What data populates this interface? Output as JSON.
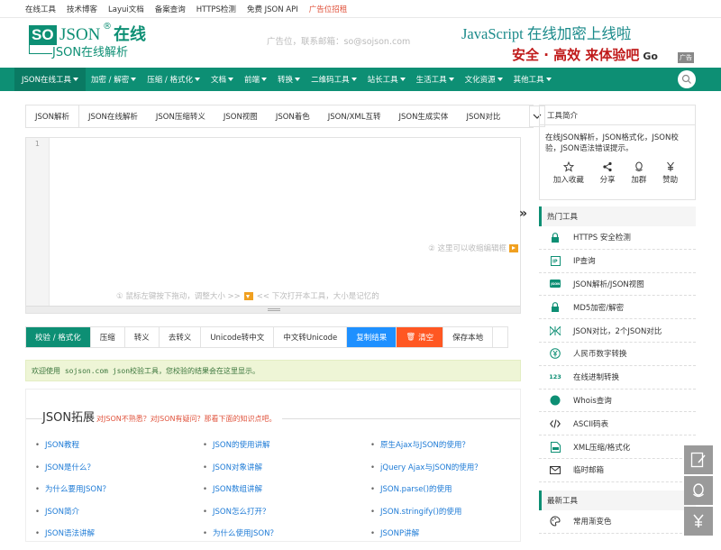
{
  "topbar": {
    "links": [
      "在线工具",
      "技术博客",
      "Layui文档",
      "备案查询",
      "HTTPS检测",
      "免费 JSON API"
    ],
    "ad_link": "广告位招租"
  },
  "header": {
    "logo_so": "SO",
    "logo_json": "JSON",
    "logo_reg": "®",
    "logo_zx": "在线",
    "logo_sub": "JSON在线解析",
    "ad_text": "广告位，联系邮箱：so@sojson.com",
    "banner_line1": "JavaScript 在线加密上线啦",
    "banner_line2": "安全 · 高效  来体验吧",
    "banner_go": "Go",
    "banner_badge": "广告"
  },
  "nav": {
    "items": [
      {
        "label": "JSON在线工具"
      },
      {
        "label": "加密 / 解密"
      },
      {
        "label": "压缩 / 格式化"
      },
      {
        "label": "文档"
      },
      {
        "label": "前端"
      },
      {
        "label": "转换"
      },
      {
        "label": "二维码工具"
      },
      {
        "label": "站长工具"
      },
      {
        "label": "生活工具"
      },
      {
        "label": "文化资源"
      },
      {
        "label": "其他工具"
      }
    ]
  },
  "tabs": [
    "JSON解析",
    "JSON在线解析",
    "JSON压缩转义",
    "JSON视图",
    "JSON着色",
    "JSON/XML互转",
    "JSON生成实体",
    "JSON对比"
  ],
  "editor": {
    "line_no": "1",
    "collapse_hint": "② 这里可以收缩编辑框",
    "drag_hint_1": "① 鼠标左键按下拖动，调整大小 >>",
    "drag_hint_2": "<< 下次打开本工具，大小是记忆的"
  },
  "actions": {
    "validate": "校验 / 格式化",
    "compress": "压缩",
    "escape": "转义",
    "unescape": "去转义",
    "unicode_to_cn": "Unicode转中文",
    "cn_to_unicode": "中文转Unicode",
    "copy": "复制结果",
    "clear": "清空",
    "save": "保存本地"
  },
  "result_text": "欢迎使用 sojson.com json校验工具，您校验的结果会在这里显示。",
  "extension": {
    "title": "JSON拓展",
    "subtitle": "对JSON不熟悉？对JSON有疑问？那看下面的知识点吧。",
    "col1": [
      "JSON教程",
      "JSON是什么？",
      "为什么要用JSON？",
      "JSON简介",
      "JSON语法讲解"
    ],
    "col2": [
      "JSON的使用讲解",
      "JSON对象讲解",
      "JSON数组讲解",
      "JSON怎么打开？",
      "为什么使用JSON？"
    ],
    "col3": [
      "原生Ajax与JSON的使用？",
      "jQuery Ajax与JSON的使用？",
      "JSON.parse()的使用",
      "JSON.stringify()的使用",
      "JSONP讲解"
    ]
  },
  "sidebar": {
    "intro_title": "工具简介",
    "intro_text": "在线JSON解析，JSON格式化，JSON校验，JSON语法错误提示。",
    "actions": [
      {
        "label": "加入收藏",
        "icon": "star-icon"
      },
      {
        "label": "分享",
        "icon": "share-icon"
      },
      {
        "label": "加群",
        "icon": "qq-icon"
      },
      {
        "label": "赞助",
        "icon": "yen-icon"
      }
    ],
    "hot_title": "热门工具",
    "hot_tools": [
      {
        "label": "HTTPS 安全检测",
        "icon": "lock-icon"
      },
      {
        "label": "IP查询",
        "icon": "ip-icon"
      },
      {
        "label": "JSON解析/JSON视图",
        "icon": "json-icon"
      },
      {
        "label": "MD5加密/解密",
        "icon": "lock-icon"
      },
      {
        "label": "JSON对比，2个JSON对比",
        "icon": "compare-icon"
      },
      {
        "label": "人民币数字转换",
        "icon": "yen-circle-icon"
      },
      {
        "label": "在线进制转换",
        "icon": "number-icon"
      },
      {
        "label": "Whois查询",
        "icon": "globe-icon"
      },
      {
        "label": "ASCII码表",
        "icon": "code-icon"
      },
      {
        "label": "XML压缩/格式化",
        "icon": "xml-icon"
      },
      {
        "label": "临时邮箱",
        "icon": "mail-icon"
      }
    ],
    "new_title": "最新工具",
    "new_tools": [
      {
        "label": "常用渐变色",
        "icon": "palette-icon"
      }
    ],
    "number_icon_text": "123",
    "json_icon_text": "JSON"
  },
  "colors": {
    "brand": "#0d8f74",
    "copy": "#1e90ff",
    "clear": "#ff5722"
  }
}
